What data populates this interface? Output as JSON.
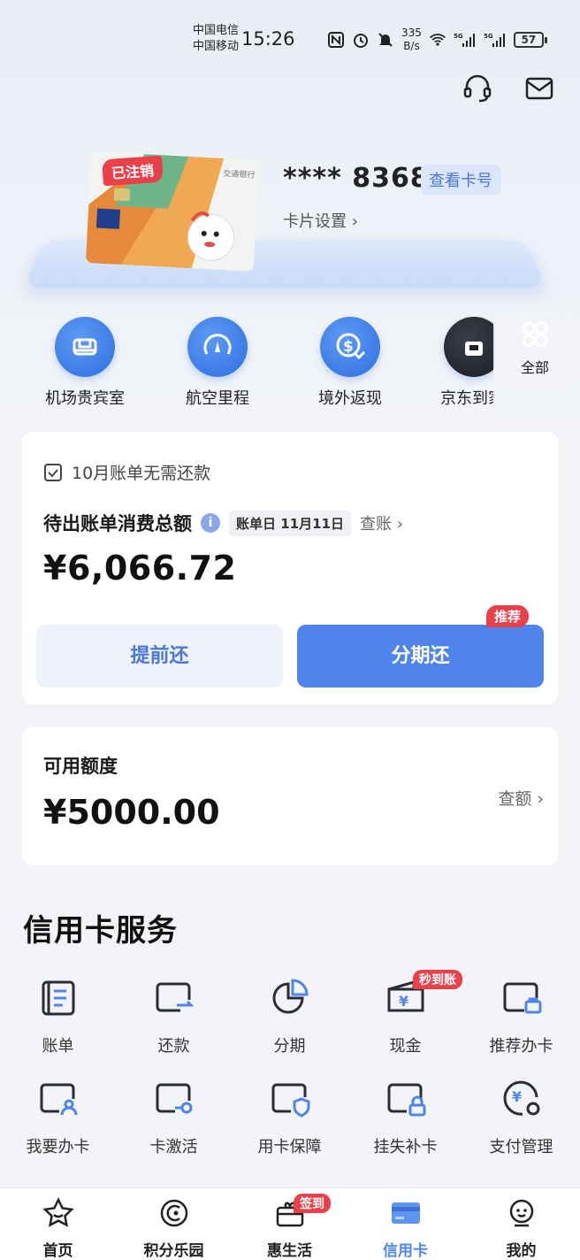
{
  "status_bar": {
    "carrier1": "中国电信",
    "carrier2": "中国移动",
    "time": "15:26",
    "net_speed_value": "335",
    "net_speed_unit": "B/s",
    "battery": "57"
  },
  "card": {
    "status_badge": "已注销",
    "masked_number": "**** 8368",
    "view_number_button": "查看卡号",
    "settings_link": "卡片设置"
  },
  "quick_actions": [
    {
      "label": "机场贵宾室",
      "icon": "sofa-icon"
    },
    {
      "label": "航空里程",
      "icon": "gauge-icon"
    },
    {
      "label": "境外返现",
      "icon": "cashback-icon"
    },
    {
      "label": "京东到家",
      "icon": "shop-icon"
    },
    {
      "label": "全部",
      "icon": "grid-icon"
    }
  ],
  "bill": {
    "hint": "10月账单无需还款",
    "title": "待出账单消费总额",
    "bill_date": "账单日 11月11日",
    "check_link": "查账",
    "amount": "¥6,066.72",
    "early_repay_button": "提前还",
    "installment_button": "分期还",
    "recommend_badge": "推荐"
  },
  "credit": {
    "title": "可用额度",
    "amount": "¥5000.00",
    "check_link": "查额"
  },
  "services": {
    "title": "信用卡服务",
    "items": [
      {
        "label": "账单",
        "icon": "bill-icon"
      },
      {
        "label": "还款",
        "icon": "repay-icon"
      },
      {
        "label": "分期",
        "icon": "pie-chart-icon"
      },
      {
        "label": "现金",
        "icon": "cash-icon",
        "badge": "秒到账"
      },
      {
        "label": "推荐办卡",
        "icon": "recommend-card-icon"
      },
      {
        "label": "我要办卡",
        "icon": "apply-card-icon"
      },
      {
        "label": "卡激活",
        "icon": "activate-card-icon"
      },
      {
        "label": "用卡保障",
        "icon": "card-protect-icon"
      },
      {
        "label": "挂失补卡",
        "icon": "lost-card-icon"
      },
      {
        "label": "支付管理",
        "icon": "payment-manage-icon"
      }
    ]
  },
  "bottom_nav": [
    {
      "label": "首页",
      "icon": "star-icon"
    },
    {
      "label": "积分乐园",
      "icon": "points-icon"
    },
    {
      "label": "惠生活",
      "icon": "gift-box-icon",
      "badge": "签到"
    },
    {
      "label": "信用卡",
      "icon": "credit-card-icon",
      "active": true
    },
    {
      "label": "我的",
      "icon": "profile-icon"
    }
  ],
  "colors": {
    "accent": "#4f84ec",
    "badge_red": "#e9404a",
    "quick_action_blue": "#2e6fe0"
  }
}
